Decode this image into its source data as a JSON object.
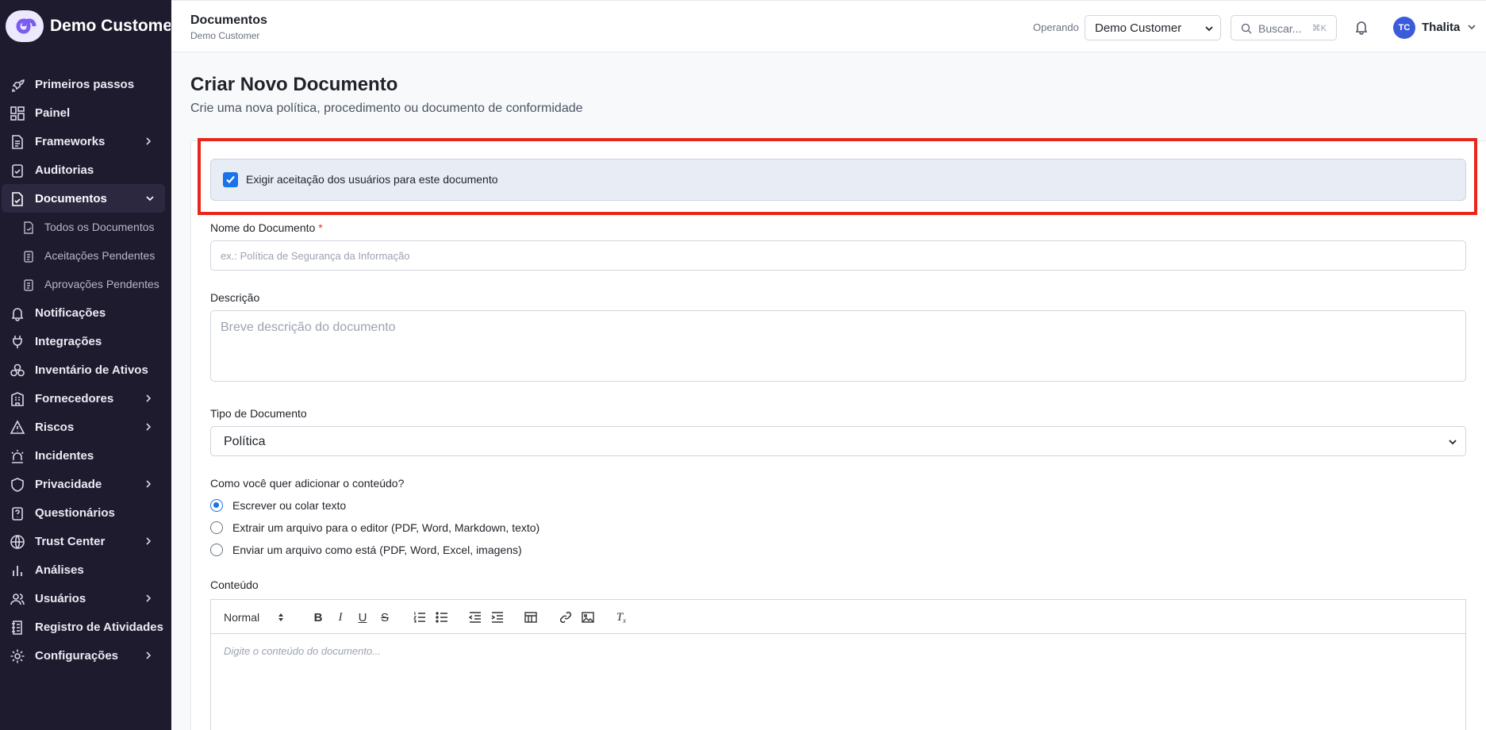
{
  "brand": {
    "name": "Demo Customer"
  },
  "sidebar": {
    "items": [
      {
        "label": "Primeiros passos",
        "icon": "rocket-icon"
      },
      {
        "label": "Painel",
        "icon": "dashboard-icon"
      },
      {
        "label": "Frameworks",
        "icon": "document-icon"
      },
      {
        "label": "Auditorias",
        "icon": "clipboard-check-icon"
      },
      {
        "label": "Documentos",
        "icon": "file-check-icon"
      },
      {
        "label": "Todos os Documentos",
        "icon": "file-icon"
      },
      {
        "label": "Aceitações Pendentes",
        "icon": "clipboard-icon"
      },
      {
        "label": "Aprovações Pendentes",
        "icon": "clipboard-icon"
      },
      {
        "label": "Notificações",
        "icon": "bell-icon"
      },
      {
        "label": "Integrações",
        "icon": "plug-icon"
      },
      {
        "label": "Inventário de Ativos",
        "icon": "boxes-icon"
      },
      {
        "label": "Fornecedores",
        "icon": "building-icon"
      },
      {
        "label": "Riscos",
        "icon": "warning-icon"
      },
      {
        "label": "Incidentes",
        "icon": "siren-icon"
      },
      {
        "label": "Privacidade",
        "icon": "shield-icon"
      },
      {
        "label": "Questionários",
        "icon": "questionnaire-icon"
      },
      {
        "label": "Trust Center",
        "icon": "globe-icon"
      },
      {
        "label": "Análises",
        "icon": "bar-chart-icon"
      },
      {
        "label": "Usuários",
        "icon": "users-icon"
      },
      {
        "label": "Registro de Atividades",
        "icon": "log-icon"
      },
      {
        "label": "Configurações",
        "icon": "gear-icon"
      }
    ]
  },
  "topbar": {
    "title": "Documentos",
    "subtitle": "Demo Customer",
    "operating_label": "Operando",
    "operating_value": "Demo Customer",
    "search_placeholder": "Buscar...",
    "search_shortcut": "⌘K",
    "avatar_initials": "TC",
    "user_name": "Thalita"
  },
  "page": {
    "title": "Criar Novo Documento",
    "subtitle": "Crie uma nova política, procedimento ou documento de conformidade"
  },
  "form": {
    "require_acceptance_label": "Exigir aceitação dos usuários para este documento",
    "require_acceptance_checked": true,
    "name_label": "Nome do Documento",
    "required_mark": "*",
    "name_placeholder": "ex.: Política de Segurança da Informação",
    "description_label": "Descrição",
    "description_placeholder": "Breve descrição do documento",
    "type_label": "Tipo de Documento",
    "type_value": "Política",
    "content_method_label": "Como você quer adicionar o conteúdo?",
    "content_methods": [
      {
        "label": "Escrever ou colar texto",
        "selected": true
      },
      {
        "label": "Extrair um arquivo para o editor (PDF, Word, Markdown, texto)",
        "selected": false
      },
      {
        "label": "Enviar um arquivo como está (PDF, Word, Excel, imagens)",
        "selected": false
      }
    ],
    "content_label": "Conteúdo",
    "editor_style": "Normal",
    "editor_placeholder": "Digite o conteúdo do documento..."
  },
  "colors": {
    "sidebar_bg": "#1e1b2e",
    "accent": "#1a73e8",
    "highlight": "#e8261b",
    "avatar": "#3b5bdb"
  }
}
